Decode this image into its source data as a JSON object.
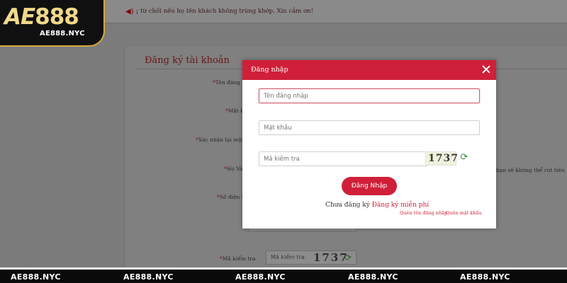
{
  "logo": {
    "brand_a": "AE",
    "brand_b": "888",
    "site": "AE888.NYC"
  },
  "notice": {
    "icon": "speaker-icon",
    "text": "¡ từ chối nếu họ tên khách không trùng khớp. Xin cảm ơn!"
  },
  "register_panel": {
    "title": "Đăng ký tài khoản",
    "labels": [
      "Tên đăng n",
      "Mật k",
      "Xác nhận lại mật k",
      "Họ Và",
      "Số điện th",
      "Mã kiểm tra"
    ],
    "side_note": "bạn sẽ không thể rút tiền",
    "captcha_placeholder": "Mã kiểm tra",
    "captcha_code": "1737"
  },
  "modal": {
    "title": "Đăng nhập",
    "username_placeholder": "Tên đăng nhập",
    "password_placeholder": "Mật khẩu",
    "captcha_placeholder": "Mã kiểm tra",
    "captcha_code": "1737",
    "login_button": "Đăng Nhập",
    "no_account": "Chưa đăng ký",
    "register_link": "Đăng ký miễn phí",
    "forgot_username": "Quên tên đăng nhập",
    "forgot_password": "Quên mật khẩu",
    "accent_color": "#d01f38"
  },
  "watermarks": [
    "AE888.NYC",
    "AE888.NYC",
    "AE888.NYC",
    "AE888.NYC",
    "AE888.NYC"
  ]
}
